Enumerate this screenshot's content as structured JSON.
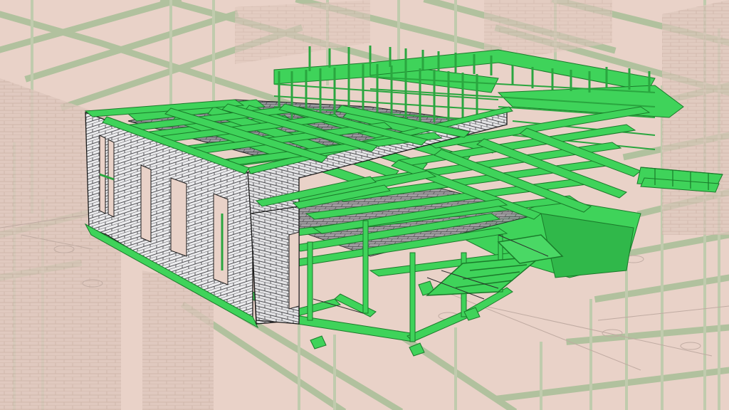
{
  "scene": {
    "subject": "3d-structural-bim-model",
    "colors": {
      "background": "#e9d2c8",
      "ghost_frame": "#a8bf97",
      "ghost_brick": "#d8c0b4",
      "steel": "#35c24f",
      "steel_dark": "#1a7a2a",
      "steel_fill": "#3fd35a",
      "masonry_light": "#e8e8ea",
      "masonry_dark": "#8e8e92",
      "outline": "#1b1b1b"
    }
  }
}
